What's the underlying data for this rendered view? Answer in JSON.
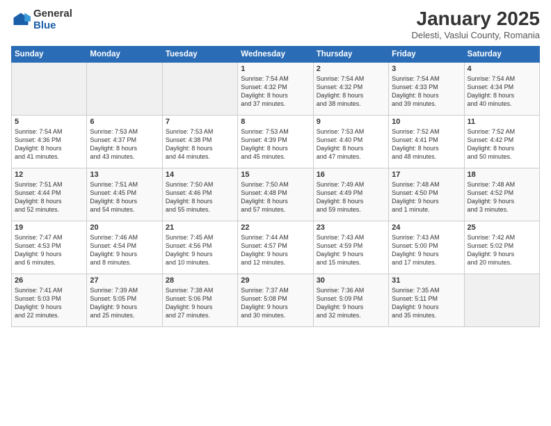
{
  "header": {
    "logo_general": "General",
    "logo_blue": "Blue",
    "title": "January 2025",
    "subtitle": "Delesti, Vaslui County, Romania"
  },
  "weekdays": [
    "Sunday",
    "Monday",
    "Tuesday",
    "Wednesday",
    "Thursday",
    "Friday",
    "Saturday"
  ],
  "weeks": [
    [
      {
        "day": "",
        "info": ""
      },
      {
        "day": "",
        "info": ""
      },
      {
        "day": "",
        "info": ""
      },
      {
        "day": "1",
        "info": "Sunrise: 7:54 AM\nSunset: 4:32 PM\nDaylight: 8 hours\nand 37 minutes."
      },
      {
        "day": "2",
        "info": "Sunrise: 7:54 AM\nSunset: 4:32 PM\nDaylight: 8 hours\nand 38 minutes."
      },
      {
        "day": "3",
        "info": "Sunrise: 7:54 AM\nSunset: 4:33 PM\nDaylight: 8 hours\nand 39 minutes."
      },
      {
        "day": "4",
        "info": "Sunrise: 7:54 AM\nSunset: 4:34 PM\nDaylight: 8 hours\nand 40 minutes."
      }
    ],
    [
      {
        "day": "5",
        "info": "Sunrise: 7:54 AM\nSunset: 4:36 PM\nDaylight: 8 hours\nand 41 minutes."
      },
      {
        "day": "6",
        "info": "Sunrise: 7:53 AM\nSunset: 4:37 PM\nDaylight: 8 hours\nand 43 minutes."
      },
      {
        "day": "7",
        "info": "Sunrise: 7:53 AM\nSunset: 4:38 PM\nDaylight: 8 hours\nand 44 minutes."
      },
      {
        "day": "8",
        "info": "Sunrise: 7:53 AM\nSunset: 4:39 PM\nDaylight: 8 hours\nand 45 minutes."
      },
      {
        "day": "9",
        "info": "Sunrise: 7:53 AM\nSunset: 4:40 PM\nDaylight: 8 hours\nand 47 minutes."
      },
      {
        "day": "10",
        "info": "Sunrise: 7:52 AM\nSunset: 4:41 PM\nDaylight: 8 hours\nand 48 minutes."
      },
      {
        "day": "11",
        "info": "Sunrise: 7:52 AM\nSunset: 4:42 PM\nDaylight: 8 hours\nand 50 minutes."
      }
    ],
    [
      {
        "day": "12",
        "info": "Sunrise: 7:51 AM\nSunset: 4:44 PM\nDaylight: 8 hours\nand 52 minutes."
      },
      {
        "day": "13",
        "info": "Sunrise: 7:51 AM\nSunset: 4:45 PM\nDaylight: 8 hours\nand 54 minutes."
      },
      {
        "day": "14",
        "info": "Sunrise: 7:50 AM\nSunset: 4:46 PM\nDaylight: 8 hours\nand 55 minutes."
      },
      {
        "day": "15",
        "info": "Sunrise: 7:50 AM\nSunset: 4:48 PM\nDaylight: 8 hours\nand 57 minutes."
      },
      {
        "day": "16",
        "info": "Sunrise: 7:49 AM\nSunset: 4:49 PM\nDaylight: 8 hours\nand 59 minutes."
      },
      {
        "day": "17",
        "info": "Sunrise: 7:48 AM\nSunset: 4:50 PM\nDaylight: 9 hours\nand 1 minute."
      },
      {
        "day": "18",
        "info": "Sunrise: 7:48 AM\nSunset: 4:52 PM\nDaylight: 9 hours\nand 3 minutes."
      }
    ],
    [
      {
        "day": "19",
        "info": "Sunrise: 7:47 AM\nSunset: 4:53 PM\nDaylight: 9 hours\nand 6 minutes."
      },
      {
        "day": "20",
        "info": "Sunrise: 7:46 AM\nSunset: 4:54 PM\nDaylight: 9 hours\nand 8 minutes."
      },
      {
        "day": "21",
        "info": "Sunrise: 7:45 AM\nSunset: 4:56 PM\nDaylight: 9 hours\nand 10 minutes."
      },
      {
        "day": "22",
        "info": "Sunrise: 7:44 AM\nSunset: 4:57 PM\nDaylight: 9 hours\nand 12 minutes."
      },
      {
        "day": "23",
        "info": "Sunrise: 7:43 AM\nSunset: 4:59 PM\nDaylight: 9 hours\nand 15 minutes."
      },
      {
        "day": "24",
        "info": "Sunrise: 7:43 AM\nSunset: 5:00 PM\nDaylight: 9 hours\nand 17 minutes."
      },
      {
        "day": "25",
        "info": "Sunrise: 7:42 AM\nSunset: 5:02 PM\nDaylight: 9 hours\nand 20 minutes."
      }
    ],
    [
      {
        "day": "26",
        "info": "Sunrise: 7:41 AM\nSunset: 5:03 PM\nDaylight: 9 hours\nand 22 minutes."
      },
      {
        "day": "27",
        "info": "Sunrise: 7:39 AM\nSunset: 5:05 PM\nDaylight: 9 hours\nand 25 minutes."
      },
      {
        "day": "28",
        "info": "Sunrise: 7:38 AM\nSunset: 5:06 PM\nDaylight: 9 hours\nand 27 minutes."
      },
      {
        "day": "29",
        "info": "Sunrise: 7:37 AM\nSunset: 5:08 PM\nDaylight: 9 hours\nand 30 minutes."
      },
      {
        "day": "30",
        "info": "Sunrise: 7:36 AM\nSunset: 5:09 PM\nDaylight: 9 hours\nand 32 minutes."
      },
      {
        "day": "31",
        "info": "Sunrise: 7:35 AM\nSunset: 5:11 PM\nDaylight: 9 hours\nand 35 minutes."
      },
      {
        "day": "",
        "info": ""
      }
    ]
  ]
}
